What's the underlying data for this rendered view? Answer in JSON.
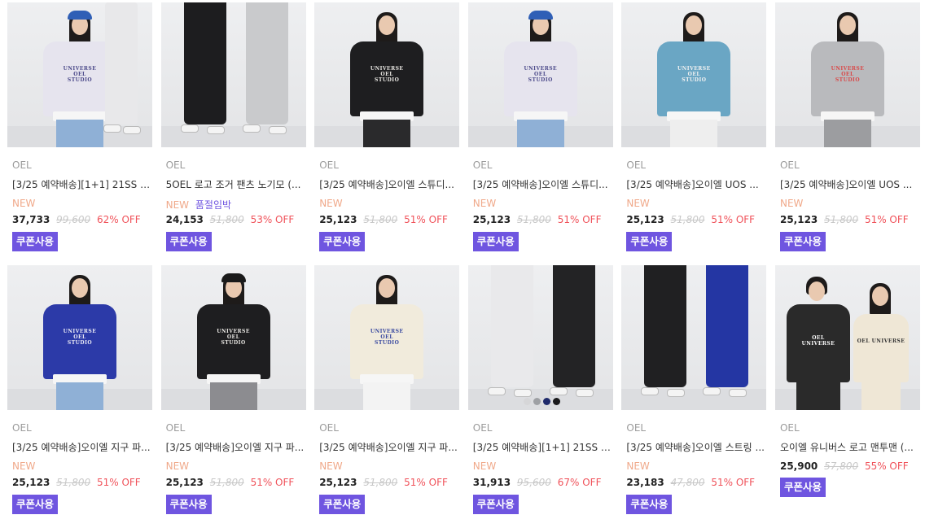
{
  "products": [
    {
      "brand": "OEL",
      "name": "[3/25 예약배송][1+1] 21SS 오...",
      "new_label": "NEW",
      "soldout_label": "",
      "price": "37,733",
      "original_price": "99,600",
      "discount": "62% OFF",
      "coupon_label": "쿠폰사용",
      "image": {
        "type": "duo-sweat",
        "torso": "#e6e4ee",
        "print": "#4c4a8a",
        "cap": "#2f5fb6",
        "bottom": "#8fb0d6"
      }
    },
    {
      "brand": "OEL",
      "name": "5OEL 로고 조거 팬츠 노기모 (...",
      "new_label": "NEW",
      "soldout_label": "품절임박",
      "price": "24,153",
      "original_price": "51,800",
      "discount": "53% OFF",
      "coupon_label": "쿠폰사용",
      "image": {
        "type": "pants",
        "left": "#1d1d1f",
        "right": "#c9cacc"
      }
    },
    {
      "brand": "OEL",
      "name": "[3/25 예약배송]오이엘 스튜디...",
      "new_label": "NEW",
      "soldout_label": "",
      "price": "25,123",
      "original_price": "51,800",
      "discount": "51% OFF",
      "coupon_label": "쿠폰사용",
      "image": {
        "type": "model",
        "torso": "#1e1e20",
        "print": "#e8e6e2",
        "cap": "",
        "bottom": "#2a2a2c"
      }
    },
    {
      "brand": "OEL",
      "name": "[3/25 예약배송]오이엘 스튜디...",
      "new_label": "NEW",
      "soldout_label": "",
      "price": "25,123",
      "original_price": "51,800",
      "discount": "51% OFF",
      "coupon_label": "쿠폰사용",
      "image": {
        "type": "model",
        "torso": "#e6e4ee",
        "print": "#4c4a8a",
        "cap": "#2f5fb6",
        "bottom": "#8fb0d6"
      }
    },
    {
      "brand": "OEL",
      "name": "[3/25 예약배송]오이엘 UOS ...",
      "new_label": "NEW",
      "soldout_label": "",
      "price": "25,123",
      "original_price": "51,800",
      "discount": "51% OFF",
      "coupon_label": "쿠폰사용",
      "image": {
        "type": "model",
        "torso": "#6aa6c4",
        "print": "#f2f2f2",
        "cap": "",
        "bottom": "#eeeeee"
      }
    },
    {
      "brand": "OEL",
      "name": "[3/25 예약배송]오이엘 UOS ...",
      "new_label": "NEW",
      "soldout_label": "",
      "price": "25,123",
      "original_price": "51,800",
      "discount": "51% OFF",
      "coupon_label": "쿠폰사용",
      "image": {
        "type": "model",
        "torso": "#b9babd",
        "print": "#d94a4a",
        "cap": "",
        "bottom": "#9c9da0"
      }
    },
    {
      "brand": "OEL",
      "name": "[3/25 예약배송]오이엘 지구 파...",
      "new_label": "NEW",
      "soldout_label": "",
      "price": "25,123",
      "original_price": "51,800",
      "discount": "51% OFF",
      "coupon_label": "쿠폰사용",
      "image": {
        "type": "model",
        "torso": "#2c3aa8",
        "print": "#e9e9f5",
        "cap": "",
        "bottom": "#8fb0d6"
      }
    },
    {
      "brand": "OEL",
      "name": "[3/25 예약배송]오이엘 지구 파...",
      "new_label": "NEW",
      "soldout_label": "",
      "price": "25,123",
      "original_price": "51,800",
      "discount": "51% OFF",
      "coupon_label": "쿠폰사용",
      "image": {
        "type": "model",
        "torso": "#1e1e20",
        "print": "#e8e6e2",
        "cap": "#1a1a1a",
        "bottom": "#8c8c90"
      }
    },
    {
      "brand": "OEL",
      "name": "[3/25 예약배송]오이엘 지구 파...",
      "new_label": "NEW",
      "soldout_label": "",
      "price": "25,123",
      "original_price": "51,800",
      "discount": "51% OFF",
      "coupon_label": "쿠폰사용",
      "image": {
        "type": "model",
        "torso": "#f1ebdc",
        "print": "#3a4aa0",
        "cap": "",
        "bottom": "#f3f3f3"
      }
    },
    {
      "brand": "OEL",
      "name": "[3/25 예약배송][1+1] 21SS 오...",
      "new_label": "NEW",
      "soldout_label": "",
      "price": "31,913",
      "original_price": "95,600",
      "discount": "67% OFF",
      "coupon_label": "쿠폰사용",
      "image": {
        "type": "pants",
        "left": "#e9e9eb",
        "right": "#232325",
        "swatches": [
          "#d6d6d8",
          "#9ea0a4",
          "#1f2a6b",
          "#1a1a1c"
        ]
      }
    },
    {
      "brand": "OEL",
      "name": "[3/25 예약배송]오이엘 스트링 ...",
      "new_label": "NEW",
      "soldout_label": "",
      "price": "23,183",
      "original_price": "47,800",
      "discount": "51% OFF",
      "coupon_label": "쿠폰사용",
      "image": {
        "type": "pants",
        "left": "#202022",
        "right": "#2436a3"
      }
    },
    {
      "brand": "OEL",
      "name": "오이엘 유니버스 로고 맨투맨 (...",
      "new_label": "",
      "soldout_label": "",
      "price": "25,900",
      "original_price": "57,800",
      "discount": "55% OFF",
      "coupon_label": "쿠폰사용",
      "image": {
        "type": "couple",
        "torso": "#2a2a2a",
        "torso2": "#efe7d6",
        "print": "#ffffff"
      }
    }
  ]
}
